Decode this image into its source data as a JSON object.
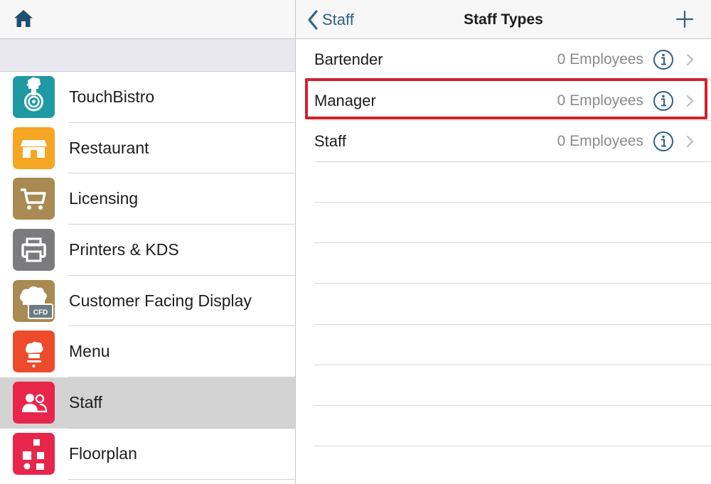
{
  "left_pane": {
    "menu_items": [
      {
        "label": "TouchBistro",
        "icon": "touchbistro-icon",
        "color": "#1f9aa3"
      },
      {
        "label": "Restaurant",
        "icon": "restaurant-store-icon",
        "color": "#f5a623"
      },
      {
        "label": "Licensing",
        "icon": "cart-icon",
        "color": "#a88a52"
      },
      {
        "label": "Printers & KDS",
        "icon": "printer-icon",
        "color": "#7b7b7e"
      },
      {
        "label": "Customer Facing Display",
        "icon": "cfd-chef-hat-icon",
        "color": "#a88a52",
        "badge": "CFD"
      },
      {
        "label": "Menu",
        "icon": "chef-hat-icon",
        "color": "#ec4b2c"
      },
      {
        "label": "Staff",
        "icon": "staff-people-icon",
        "color": "#e8264c",
        "selected": true
      },
      {
        "label": "Floorplan",
        "icon": "floorplan-icon",
        "color": "#e8264c"
      }
    ]
  },
  "right_pane": {
    "back_label": "Staff",
    "title": "Staff Types",
    "rows": [
      {
        "label": "Bartender",
        "count": "0 Employees"
      },
      {
        "label": "Manager",
        "count": "0 Employees",
        "highlighted": true
      },
      {
        "label": "Staff",
        "count": "0 Employees"
      }
    ]
  },
  "colors": {
    "accent": "#2f5f82",
    "highlight_border": "#d2202f",
    "selected_row": "#d3d3d3"
  }
}
